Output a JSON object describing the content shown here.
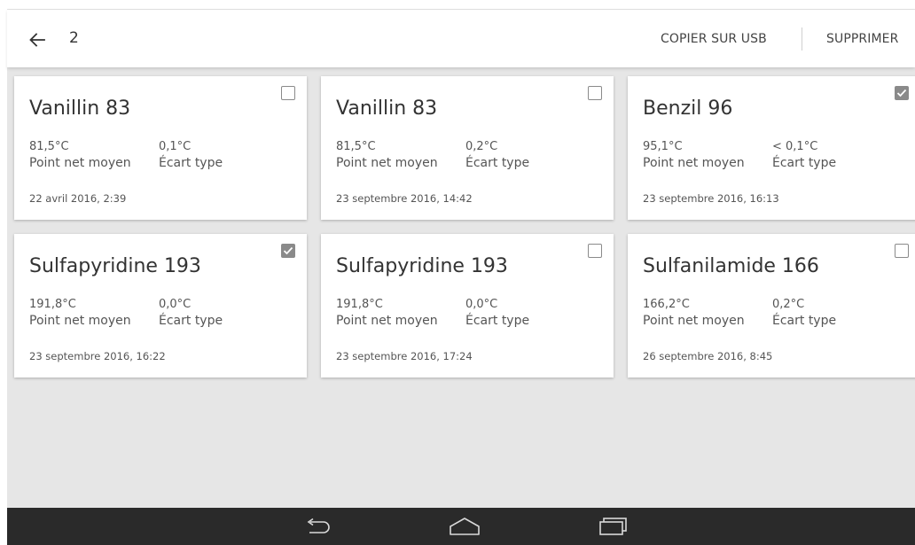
{
  "toolbar": {
    "selection_count": "2",
    "copy_label": "COPIER SUR USB",
    "delete_label": "SUPPRIMER"
  },
  "cards": [
    {
      "title": "Vanillin 83",
      "value1": "81,5°C",
      "label1": "Point net moyen",
      "value2": "0,1°C",
      "label2": "Écart type",
      "date": "22 avril 2016, 2:39",
      "checked": false
    },
    {
      "title": "Vanillin 83",
      "value1": "81,5°C",
      "label1": "Point net moyen",
      "value2": "0,2°C",
      "label2": "Écart type",
      "date": "23 septembre 2016, 14:42",
      "checked": false
    },
    {
      "title": "Benzil 96",
      "value1": "95,1°C",
      "label1": "Point net moyen",
      "value2": "< 0,1°C",
      "label2": "Écart type",
      "date": "23 septembre 2016, 16:13",
      "checked": true
    },
    {
      "title": "Sulfapyridine 193",
      "value1": "191,8°C",
      "label1": "Point net moyen",
      "value2": "0,0°C",
      "label2": "Écart type",
      "date": "23 septembre 2016, 16:22",
      "checked": true
    },
    {
      "title": "Sulfapyridine 193",
      "value1": "191,8°C",
      "label1": "Point net moyen",
      "value2": "0,0°C",
      "label2": "Écart type",
      "date": "23 septembre 2016, 17:24",
      "checked": false
    },
    {
      "title": "Sulfanilamide 166",
      "value1": "166,2°C",
      "label1": "Point net moyen",
      "value2": "0,2°C",
      "label2": "Écart type",
      "date": "26 septembre 2016, 8:45",
      "checked": false
    }
  ],
  "icons": {
    "back": "arrow-back-icon",
    "checkbox": "checkbox-icon",
    "nav_back": "nav-back-icon",
    "nav_home": "nav-home-icon",
    "nav_recents": "nav-recents-icon"
  },
  "colors": {
    "content_background": "#e6e6e6",
    "card_background": "#ffffff",
    "checkbox_checked": "#8a8a8a",
    "navbar_background": "#2a2a2a"
  }
}
